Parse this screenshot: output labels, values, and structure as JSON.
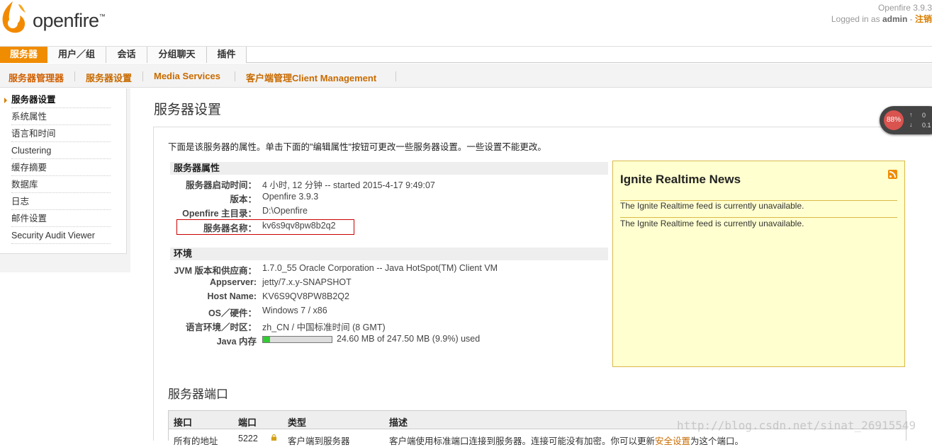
{
  "header": {
    "logo_text": "openfire",
    "logo_mark": "™",
    "version": "Openfire 3.9.3",
    "logged_in_prefix": "Logged in as",
    "user": "admin",
    "sep": "-",
    "logout_label": "注销"
  },
  "main_tabs": [
    "服务器",
    "用户／组",
    "会话",
    "分组聊天",
    "插件"
  ],
  "sub_tabs": [
    "服务器管理器",
    "服务器设置",
    "Media Services",
    "客户端管理Client Management"
  ],
  "sidebar": {
    "items": [
      "服务器设置",
      "系统属性",
      "语言和时间",
      "Clustering",
      "缓存摘要",
      "数据库",
      "日志",
      "邮件设置",
      "Security Audit Viewer"
    ]
  },
  "page": {
    "title": "服务器设置",
    "intro": "下面是该服务器的属性。单击下面的\"编辑属性\"按钮可更改一些服务器设置。一些设置不能更改。"
  },
  "server_props": {
    "heading": "服务器属性",
    "rows": [
      {
        "label": "服务器启动时间：",
        "value": "4 小时, 12 分钟 -- started 2015-4-17 9:49:07"
      },
      {
        "label": "版本：",
        "value": "Openfire 3.9.3"
      },
      {
        "label": "Openfire 主目录：",
        "value": "D:\\Openfire"
      },
      {
        "label": "服务器名称：",
        "value": "kv6s9qv8pw8b2q2"
      }
    ]
  },
  "environment": {
    "heading": "环境",
    "rows": [
      {
        "label": "JVM 版本和供应商：",
        "value": "1.7.0_55 Oracle Corporation -- Java HotSpot(TM) Client VM"
      },
      {
        "label": "Appserver:",
        "value": "jetty/7.x.y-SNAPSHOT"
      },
      {
        "label": "Host Name:",
        "value": "KV6S9QV8PW8B2Q2"
      },
      {
        "label": "OS／硬件：",
        "value": "Windows 7 / x86"
      },
      {
        "label": "语言环境／时区：",
        "value": "zh_CN / 中国标准时间 (8 GMT)"
      },
      {
        "label": "Java 内存",
        "value": "24.60 MB of 247.50 MB (9.9%) used"
      }
    ],
    "memory_used_fraction": 0.099
  },
  "news": {
    "title": "Ignite Realtime News",
    "icon": "rss-icon",
    "items": [
      "The Ignite Realtime feed is currently unavailable.",
      "The Ignite Realtime feed is currently unavailable."
    ]
  },
  "ports": {
    "title": "服务器端口",
    "headers": [
      "接口",
      "端口",
      "类型",
      "描述"
    ],
    "row": [
      "所有的地址",
      "5222",
      "客户端到服务器",
      "客户端使用标准端口连接到服务器。连接可能没有加密。你可以更新",
      "安全设置",
      "为这个端口。"
    ]
  },
  "gauge": {
    "percent": "88%",
    "up_value": "0",
    "down_value": "0.1"
  },
  "watermark": "http://blog.csdn.net/sinat_26915549",
  "colors": {
    "accent": "#f08c00",
    "link": "#c96b00",
    "news_bg": "#ffffcf"
  }
}
